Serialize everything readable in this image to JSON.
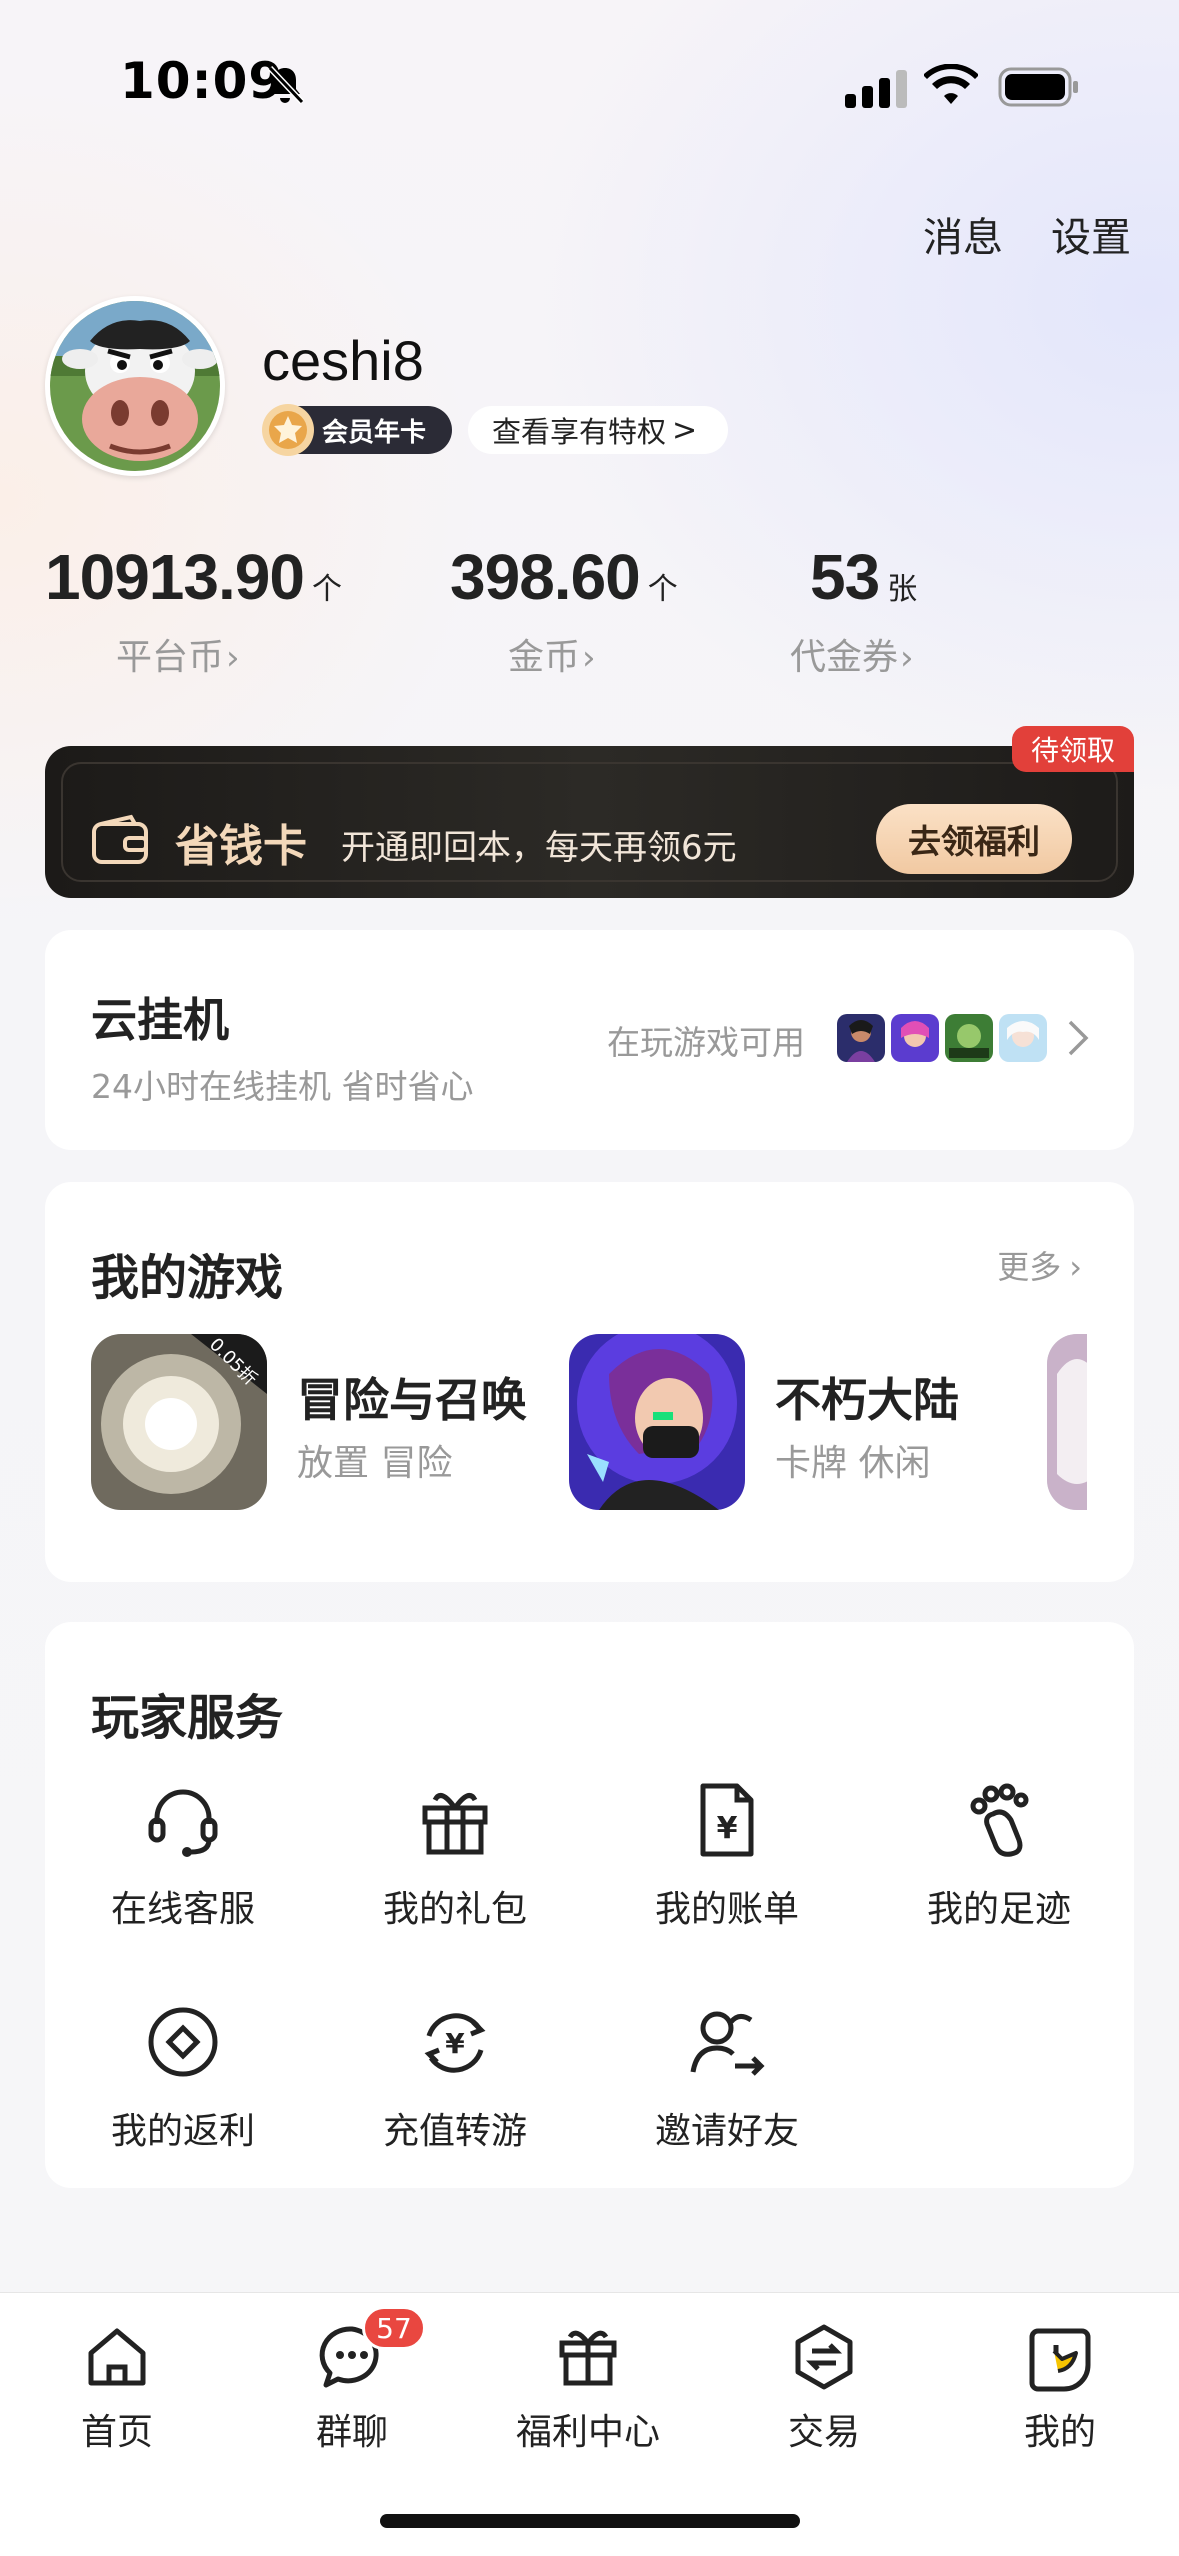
{
  "status_bar": {
    "time": "10:09"
  },
  "header": {
    "messages_label": "消息",
    "settings_label": "设置"
  },
  "profile": {
    "username": "ceshi8",
    "vip_badge": "会员年卡",
    "perks_link": "查看享有特权",
    "perks_chevron": ">"
  },
  "stats": [
    {
      "value": "10913.90",
      "unit": "个",
      "label": "平台币"
    },
    {
      "value": "398.60",
      "unit": "个",
      "label": "金币"
    },
    {
      "value": "53",
      "unit": "张",
      "label": "代金券"
    }
  ],
  "stat_chevron": "›",
  "money_card": {
    "tag": "待领取",
    "title": "省钱卡",
    "description": "开通即回本，每天再领6元",
    "button": "去领福利"
  },
  "cloud_hosting": {
    "title": "云挂机",
    "subtitle": "24小时在线挂机 省时省心",
    "availability": "在玩游戏可用"
  },
  "my_games": {
    "title": "我的游戏",
    "more": "更多",
    "more_chevron": "›",
    "items": [
      {
        "name": "冒险与召唤",
        "tags": "放置 冒险",
        "icon_label": "0.05折"
      },
      {
        "name": "不朽大陆",
        "tags": "卡牌 休闲"
      }
    ]
  },
  "services": {
    "title": "玩家服务",
    "items": [
      {
        "label": "在线客服",
        "icon": "headset-icon"
      },
      {
        "label": "我的礼包",
        "icon": "gift-icon"
      },
      {
        "label": "我的账单",
        "icon": "bill-icon"
      },
      {
        "label": "我的足迹",
        "icon": "footprint-icon"
      },
      {
        "label": "我的返利",
        "icon": "rebate-icon"
      },
      {
        "label": "充值转游",
        "icon": "recharge-transfer-icon"
      },
      {
        "label": "邀请好友",
        "icon": "invite-friend-icon"
      }
    ]
  },
  "tab_bar": {
    "items": [
      {
        "label": "首页",
        "icon": "home-icon"
      },
      {
        "label": "群聊",
        "icon": "chat-icon"
      },
      {
        "label": "福利中心",
        "icon": "welfare-icon"
      },
      {
        "label": "交易",
        "icon": "trade-icon"
      },
      {
        "label": "我的",
        "icon": "profile-icon"
      }
    ],
    "chat_badge": "57"
  },
  "colors": {
    "accent_red": "#e94740",
    "money_gold": "#f3d8ba",
    "money_button": "#f1c9a2"
  }
}
